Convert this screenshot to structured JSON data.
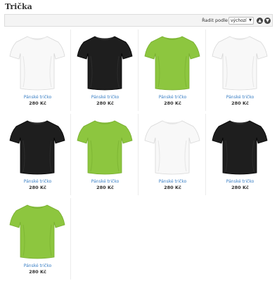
{
  "page": {
    "title": "Trička"
  },
  "sort": {
    "label": "Řadit podle",
    "selected": "výchozí"
  },
  "colors": {
    "white": "#f8f8f8",
    "black": "#1e1e1e",
    "green": "#8dc63f",
    "link": "#3a7fc4"
  },
  "products": [
    {
      "name": "Pánské tričko",
      "price": "280 Kč",
      "color": "white"
    },
    {
      "name": "Pánské tričko",
      "price": "280 Kč",
      "color": "black"
    },
    {
      "name": "Pánské tričko",
      "price": "280 Kč",
      "color": "green"
    },
    {
      "name": "Pánské tričko",
      "price": "280 Kč",
      "color": "white"
    },
    {
      "name": "Pánské tričko",
      "price": "280 Kč",
      "color": "black"
    },
    {
      "name": "Pánské tričko",
      "price": "280 Kč",
      "color": "green"
    },
    {
      "name": "Pánské tričko",
      "price": "280 Kč",
      "color": "white"
    },
    {
      "name": "Pánské tričko",
      "price": "280 Kč",
      "color": "black"
    },
    {
      "name": "Pánské tričko",
      "price": "280 Kč",
      "color": "green"
    }
  ]
}
